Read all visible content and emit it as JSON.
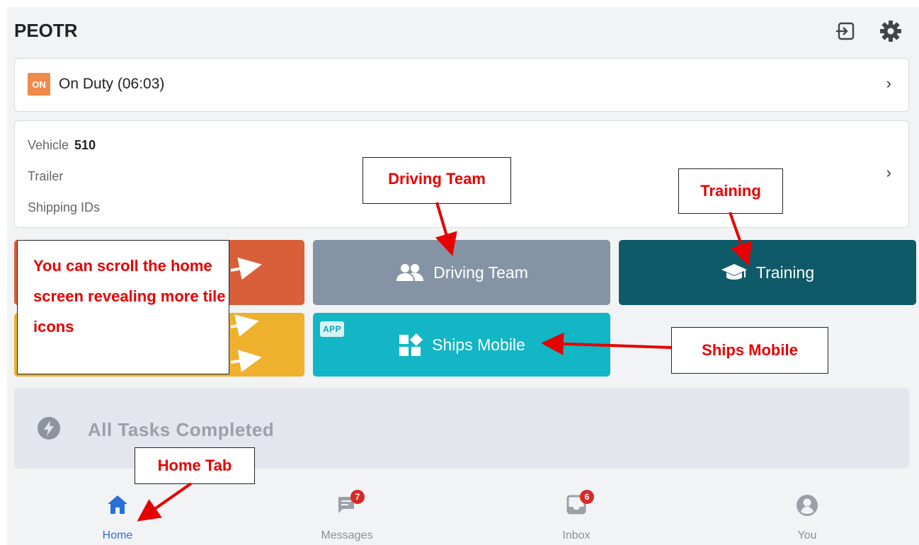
{
  "header": {
    "title": "PEOTR",
    "logout_icon": "logout-icon",
    "settings_icon": "gear-icon"
  },
  "duty": {
    "badge": "ON",
    "status": "On Duty (06:03)",
    "badge_color": "#f08a4b"
  },
  "vehicle": {
    "vehicle_label": "Vehicle",
    "vehicle_value": "510",
    "trailer_label": "Trailer",
    "shipping_label": "Shipping IDs"
  },
  "tiles": {
    "driving_team": "Driving Team",
    "training": "Training",
    "ships_mobile": "Ships Mobile",
    "ships_badge": "APP"
  },
  "tasks": {
    "text": "All Tasks Completed"
  },
  "nav": {
    "home": "Home",
    "messages": "Messages",
    "messages_count": "7",
    "inbox": "Inbox",
    "inbox_count": "6",
    "you": "You",
    "active_color": "#2a6fd6"
  },
  "annotations": {
    "scroll_note": "You can scroll the home screen revealing more tile icons",
    "driving_team": "Driving Team",
    "training": "Training",
    "ships_mobile": "Ships Mobile",
    "home_tab": "Home Tab"
  }
}
